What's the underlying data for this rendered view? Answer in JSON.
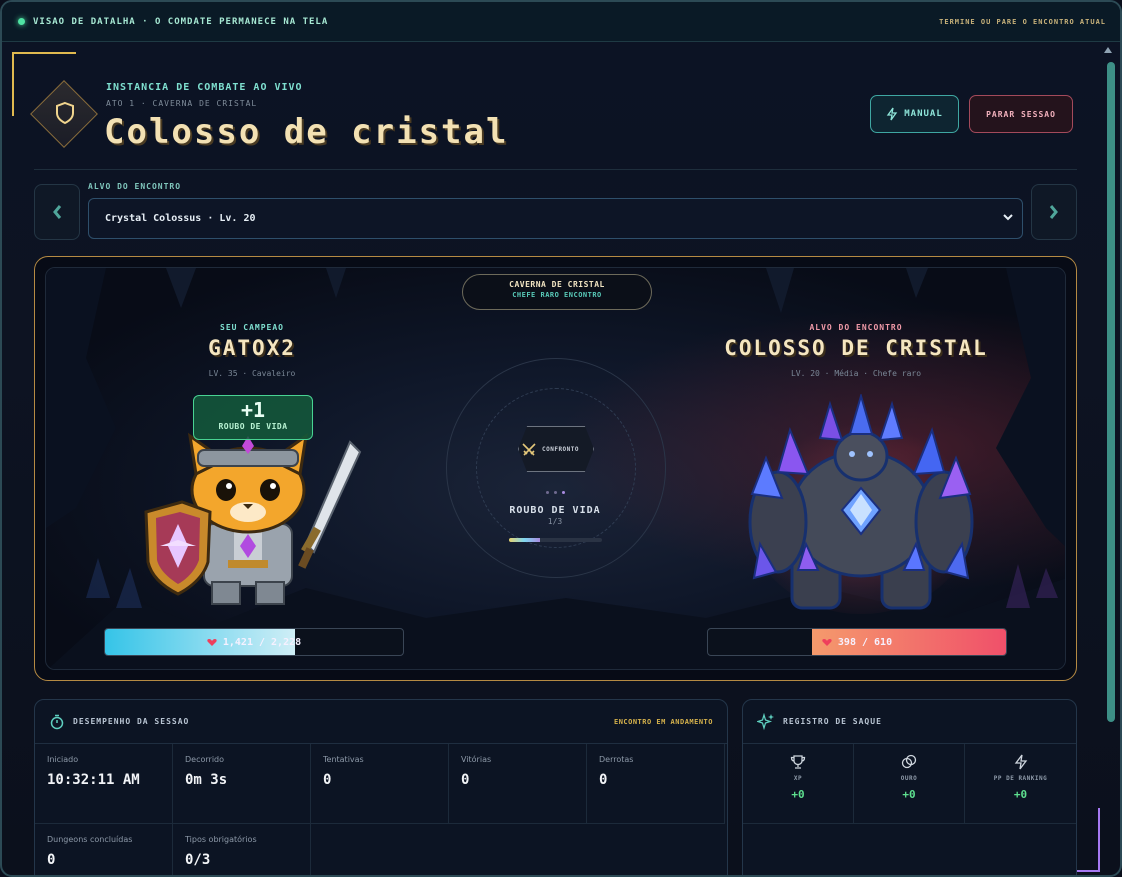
{
  "banner": {
    "left_text": "VISAO DE DATALHA · O COMDATE PERMANECE NA TELA",
    "right_text": "TERMINE OU PARE O ENCONTRO ATUAL"
  },
  "header": {
    "eyebrow": "INSTANCIA DE COMBATE AO VIVO",
    "subtitle": "ATO 1 · CAVERNA DE CRISTAL",
    "title": "Colosso de cristal",
    "manual_label": "MANUAL",
    "stop_label": "PARAR SESSAO"
  },
  "target": {
    "label": "ALVO DO ENCONTRO",
    "selected": "Crystal Colossus · Lv. 20"
  },
  "arena": {
    "location": "CAVERNA DE CRISTAL",
    "encounter_type": "CHEFE RARO ENCONTRO",
    "player": {
      "label": "SEU CAMPEAO",
      "name": "GATOX2",
      "meta": "LV. 35 · Cavaleiro",
      "hp_current": 1421,
      "hp_max": 2228,
      "hp_text": "1,421 / 2,228",
      "popup_value": "+1",
      "popup_label": "ROUBO DE VIDA"
    },
    "enemy": {
      "label": "ALVO DO ENCONTRO",
      "name": "COLOSSO DE CRISTAL",
      "meta": "LV. 20 · Média · Chefe raro",
      "hp_current": 398,
      "hp_max": 610,
      "hp_text": "398 / 610"
    },
    "center": {
      "badge": "CONFRONTO",
      "action": "ROUBO DE VIDA",
      "count": "1/3",
      "progress": 0.33
    }
  },
  "session": {
    "title": "DESEMPENHO DA SESSAO",
    "status": "ENCONTRO EM ANDAMENTO",
    "stats": [
      {
        "label": "Iniciado",
        "value": "10:32:11 AM"
      },
      {
        "label": "Decorrido",
        "value": "0m 3s"
      },
      {
        "label": "Tentativas",
        "value": "0"
      },
      {
        "label": "Vitórias",
        "value": "0"
      },
      {
        "label": "Derrotas",
        "value": "0"
      },
      {
        "label": "Dungeons concluídas",
        "value": "0"
      },
      {
        "label": "Tipos obrigatórios",
        "value": "0/3"
      }
    ]
  },
  "loot": {
    "title": "REGISTRO DE SAQUE",
    "items": [
      {
        "icon": "trophy-icon",
        "label": "XP",
        "value": "+0"
      },
      {
        "icon": "coins-icon",
        "label": "OURO",
        "value": "+0"
      },
      {
        "icon": "bolt-icon",
        "label": "PP DE RANKING",
        "value": "+0"
      }
    ]
  },
  "colors": {
    "accent_teal": "#3fa7a2",
    "gold": "#e0b94f",
    "player_hp": "#35c4e8",
    "enemy_hp": "#f0506a",
    "loot_green": "#5ee08f"
  }
}
